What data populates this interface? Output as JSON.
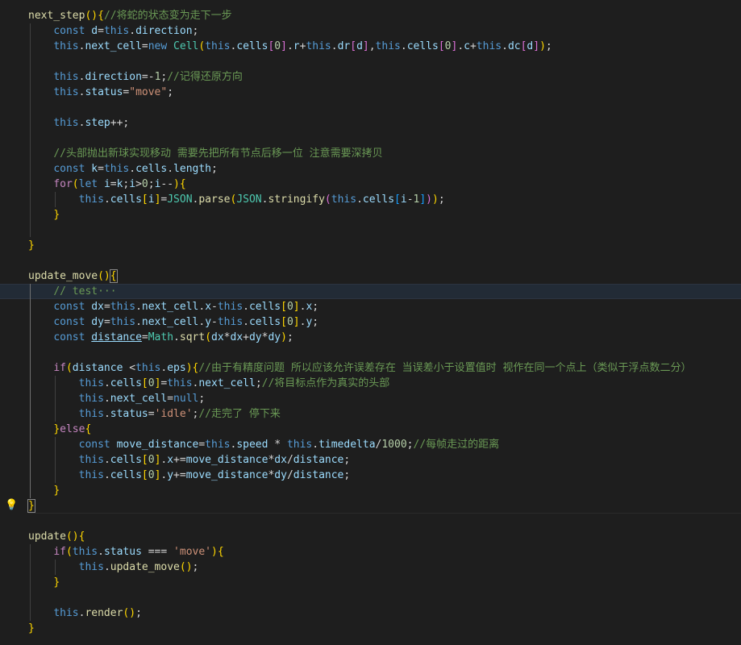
{
  "editor": {
    "theme_colors": {
      "background": "#1e1e1e",
      "keyword": "#569cd6",
      "function": "#dcdcaa",
      "variable": "#9cdcfe",
      "string": "#ce9178",
      "comment": "#6a9955",
      "number": "#b5cea8"
    },
    "lines": [
      "next_step(){//将蛇的状态变为走下一步",
      "    const d=this.direction;",
      "    this.next_cell=new Cell(this.cells[0].r+this.dr[d],this.cells[0].c+this.dc[d]);",
      "",
      "    this.direction=-1;//记得还原方向",
      "    this.status=\"move\";",
      "",
      "    this.step++;",
      "",
      "    //头部抛出新球实现移动 需要先把所有节点后移一位 注意需要深拷贝",
      "    const k=this.cells.length;",
      "    for(let i=k;i>0;i--){",
      "        this.cells[i]=JSON.parse(JSON.stringify(this.cells[i-1]));",
      "    }",
      "",
      "}",
      "",
      "update_move(){",
      "    // test···",
      "    const dx=this.next_cell.x-this.cells[0].x;",
      "    const dy=this.next_cell.y-this.cells[0].y;",
      "    const distance=Math.sqrt(dx*dx+dy*dy);",
      "",
      "    if(distance <this.eps){//由于有精度问题 所以应该允许误差存在 当误差小于设置值时 视作在同一个点上（类似于浮点数二分）",
      "        this.cells[0]=this.next_cell;//将目标点作为真实的头部",
      "        this.next_cell=null;",
      "        this.status='idle';//走完了 停下来",
      "    }else{",
      "        const move_distance=this.speed * this.timedelta/1000;//每帧走过的距离",
      "        this.cells[0].x+=move_distance*dx/distance;",
      "        this.cells[0].y+=move_distance*dy/distance;",
      "    }",
      "}",
      "",
      "update(){",
      "    if(this.status === 'move'){",
      "        this.update_move();",
      "    }",
      "",
      "    this.render();",
      "}"
    ],
    "lightbulb_icon": "lightbulb-icon"
  }
}
